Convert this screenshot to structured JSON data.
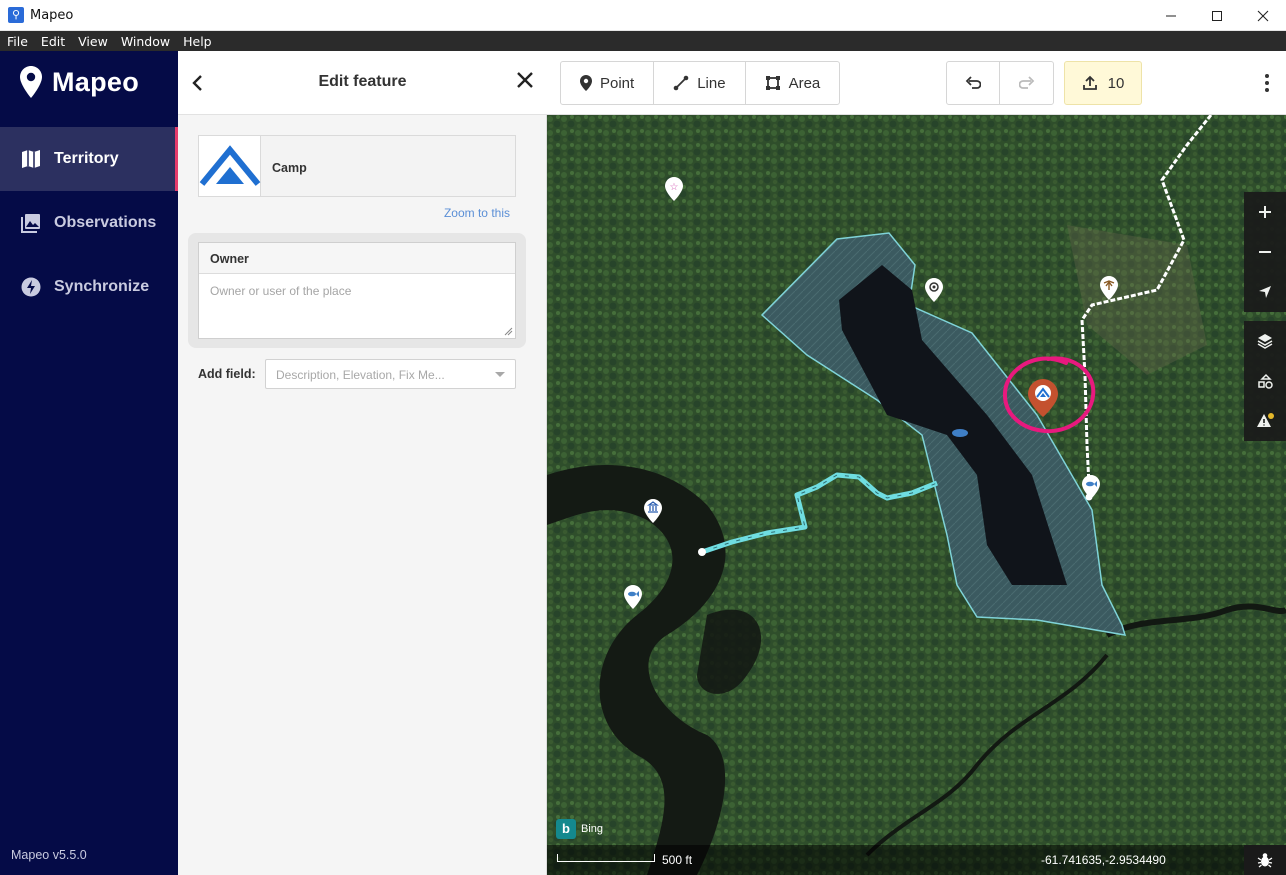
{
  "window": {
    "title": "Mapeo"
  },
  "menu": [
    "File",
    "Edit",
    "View",
    "Window",
    "Help"
  ],
  "nav": {
    "brand": "Mapeo",
    "items": [
      {
        "label": "Territory",
        "icon": "map-icon",
        "active": true
      },
      {
        "label": "Observations",
        "icon": "photos-icon",
        "active": false
      },
      {
        "label": "Synchronize",
        "icon": "sync-icon",
        "active": false
      }
    ],
    "version": "Mapeo v5.5.0"
  },
  "editor": {
    "title": "Edit feature",
    "preset_name": "Camp",
    "zoom_link": "Zoom to this",
    "field": {
      "label": "Owner",
      "placeholder": "Owner or user of the place"
    },
    "add_field_label": "Add field:",
    "add_field_placeholder": "Description, Elevation, Fix Me..."
  },
  "toolbar": {
    "point_label": "Point",
    "line_label": "Line",
    "area_label": "Area",
    "upload_count": "10"
  },
  "map": {
    "attribution": "Bing",
    "scale_label": "500 ft",
    "coordinates": "-61.741635,-2.9534490"
  },
  "colors": {
    "nav_bg": "#050b47",
    "accent_active": "#e53b6c",
    "camp_marker": "#c4512f",
    "highlight_circle": "#e8197e",
    "link": "#5b8fd6",
    "upload_bg": "#fff9d8"
  }
}
